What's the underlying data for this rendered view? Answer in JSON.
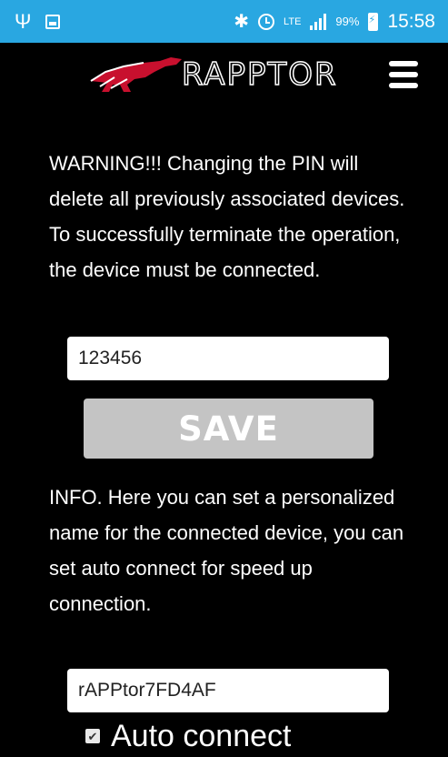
{
  "status_bar": {
    "left_icons": [
      "usb-icon",
      "image-icon"
    ],
    "right_icons": [
      "bluetooth-icon",
      "alarm-icon",
      "lte-icon",
      "signal-icon",
      "battery-icon"
    ],
    "network": "LTE",
    "battery_percent": "99%",
    "time": "15:58",
    "color": "#29a7e1"
  },
  "header": {
    "logo_text": "RAPPTOR",
    "menu_icon": "hamburger-menu-icon"
  },
  "main": {
    "warning_text": "WARNING!!! Changing the PIN will delete all previously associated devices. To successfully terminate the operation, the device must be connected.",
    "pin_value": "123456",
    "save_label": "SAVE",
    "info_text": "INFO. Here you can set a personalized name for the connected device, you can set auto connect for speed up connection.",
    "device_name_value": "rAPPtor7FD4AF",
    "auto_connect_label": "Auto connect",
    "auto_connect_checked": true
  },
  "colors": {
    "background": "#000000",
    "save_button": "#c4c4c4",
    "logo_accent": "#c8102e"
  }
}
